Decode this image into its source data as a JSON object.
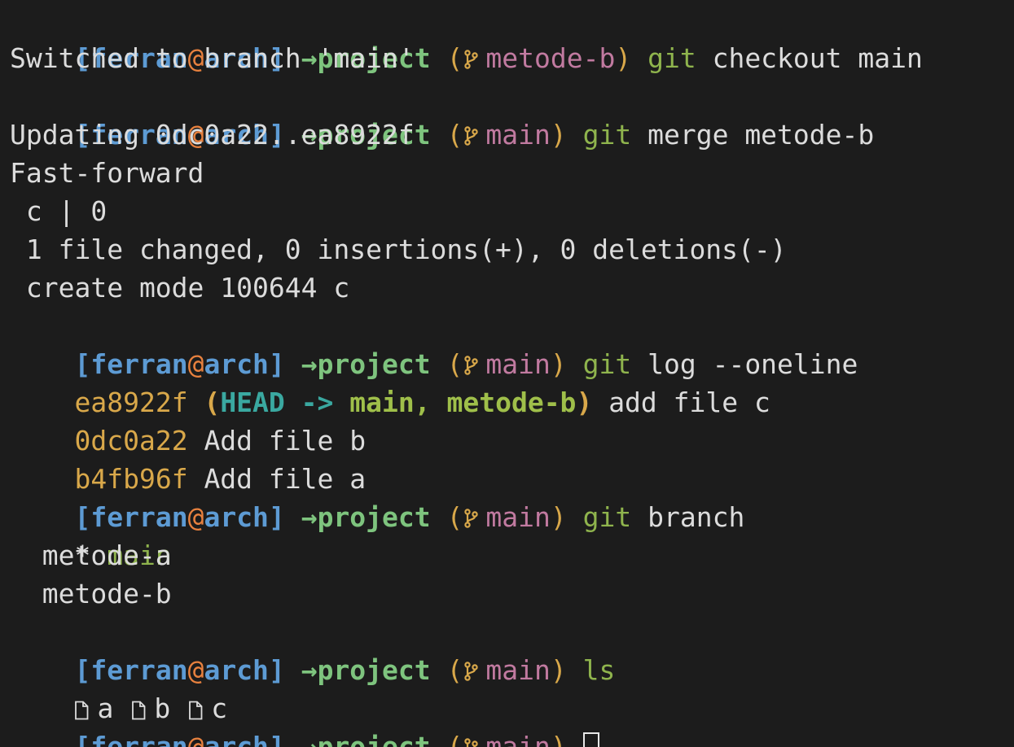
{
  "prompt": {
    "open_bracket": "[",
    "user": "ferran",
    "at": "@",
    "host": "arch",
    "close_bracket": "]",
    "arrow": "→",
    "dir": "project",
    "paren_open": "(",
    "paren_close": ")"
  },
  "lines": {
    "p1_branch": "metode-b",
    "p1_git": "git",
    "p1_args": "checkout main",
    "o1": "Switched to branch 'main'",
    "p2_branch": "main",
    "p2_git": "git",
    "p2_args": "merge metode-b",
    "o2": "Updating 0dc0a22..ea8922f",
    "o3": "Fast-forward",
    "o4": " c | 0",
    "o5": " 1 file changed, 0 insertions(+), 0 deletions(-)",
    "o6": " create mode 100644 c",
    "p3_branch": "main",
    "p3_git": "git",
    "p3_args": "log --oneline",
    "log1_hash": "ea8922f",
    "log1_open": "(",
    "log1_head": "HEAD ->",
    "log1_main": "main,",
    "log1_branch": "metode-b",
    "log1_close": ")",
    "log1_msg": "add file c",
    "log2_hash": "0dc0a22",
    "log2_msg": "Add file b",
    "log3_hash": "b4fb96f",
    "log3_msg": "Add file a",
    "p4_branch": "main",
    "p4_git": "git",
    "p4_args": "branch",
    "br_star": "*",
    "br_current": "main",
    "br_other1": "  metode-a",
    "br_other2": "  metode-b",
    "p5_branch": "main",
    "p5_cmd": "ls",
    "files": [
      "a",
      "b",
      "c"
    ],
    "p6_branch": "main"
  },
  "colors": {
    "background": "#1c1c1c",
    "prompt_user": "#5d9bd4",
    "prompt_at": "#e8813e",
    "prompt_dir": "#7ec47e",
    "branch_name": "#c17aa0",
    "hash": "#d9a84a"
  },
  "icons": {
    "branch": "git-branch-icon",
    "file": "file-icon",
    "cursor": "block-cursor"
  }
}
